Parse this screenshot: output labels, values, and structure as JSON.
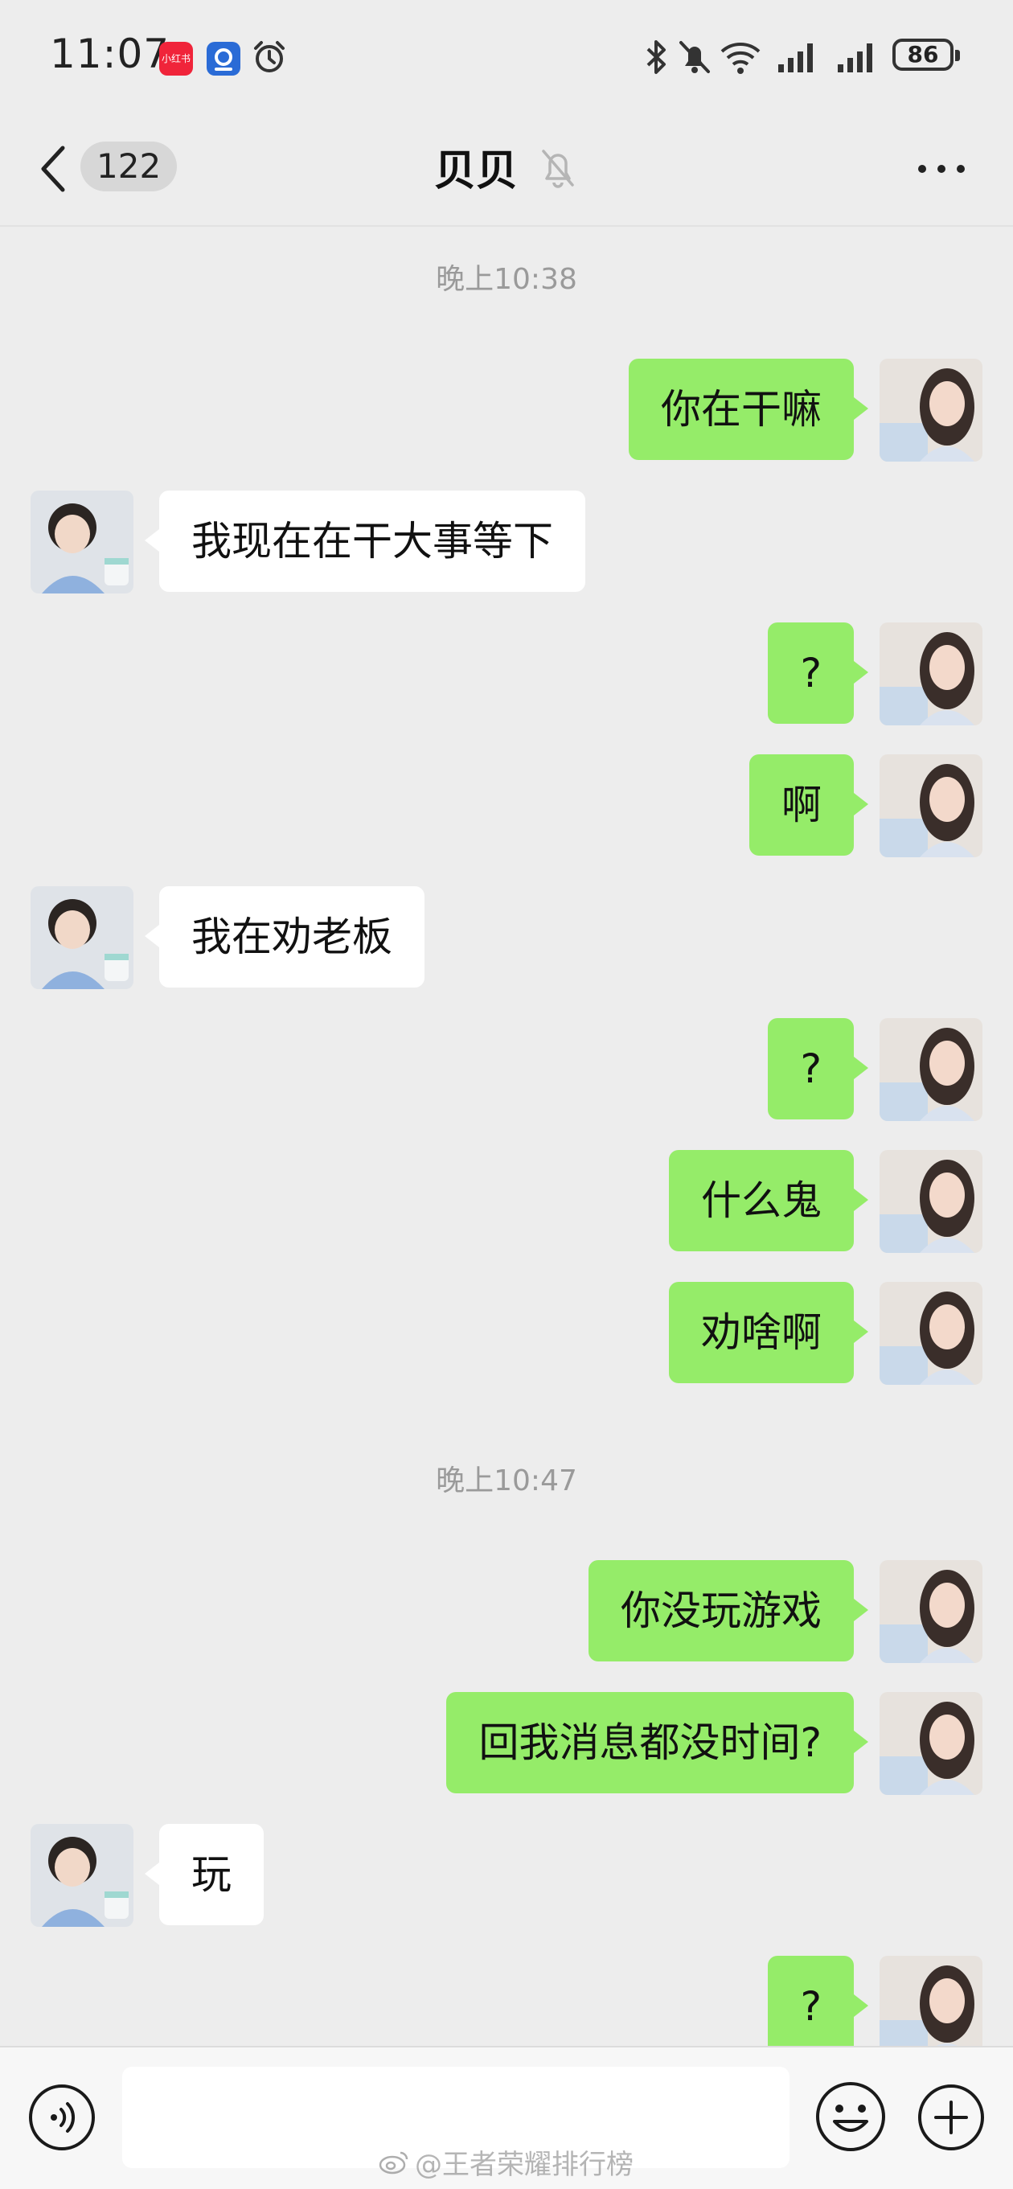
{
  "status_bar": {
    "time": "11:07",
    "app_icons": [
      {
        "name": "xiaohongshu-icon",
        "label": "小红书"
      },
      {
        "name": "app-blue-icon",
        "label": ""
      }
    ],
    "icons": [
      "alarm-icon",
      "bluetooth-icon",
      "bell-off-icon",
      "wifi-icon",
      "signal-icon",
      "signal-icon"
    ],
    "battery": "86"
  },
  "header": {
    "unread_count": "122",
    "title": "贝贝",
    "icons": [
      "back-icon",
      "bell-off-icon",
      "more-icon"
    ]
  },
  "chat": {
    "timestamps": [
      "晚上10:38",
      "晚上10:47"
    ],
    "messages": [
      {
        "side": "out",
        "text": "你在干嘛"
      },
      {
        "side": "in",
        "text": "我现在在干大事等下"
      },
      {
        "side": "out",
        "text": "?"
      },
      {
        "side": "out",
        "text": "啊"
      },
      {
        "side": "in",
        "text": "我在劝老板"
      },
      {
        "side": "out",
        "text": "?"
      },
      {
        "side": "out",
        "text": "什么鬼"
      },
      {
        "side": "out",
        "text": "劝啥啊"
      },
      {
        "side": "out",
        "text": "你没玩游戏"
      },
      {
        "side": "out",
        "text": "回我消息都没时间?"
      },
      {
        "side": "in",
        "text": "玩"
      },
      {
        "side": "out",
        "text": "?"
      }
    ]
  },
  "input_bar": {
    "placeholder": "",
    "icons": [
      "voice-icon",
      "emoji-icon",
      "plus-icon"
    ]
  },
  "watermark": "@王者荣耀排行榜",
  "colors": {
    "background": "#ededed",
    "outgoing_bubble": "#95ec69",
    "incoming_bubble": "#ffffff"
  }
}
